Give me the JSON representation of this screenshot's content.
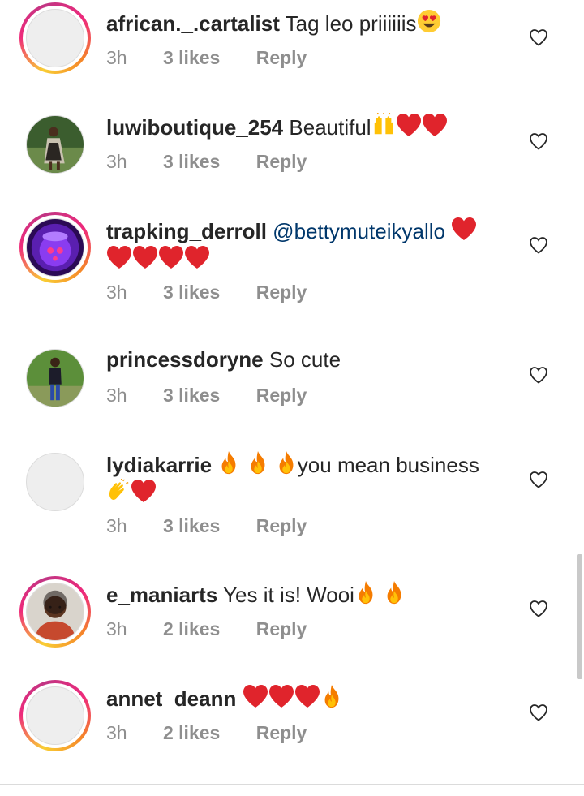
{
  "comments": [
    {
      "username": "african._.cartalist",
      "text": "Tag leo priiiiiis",
      "emojis": [
        "heart-eyes"
      ],
      "time": "3h",
      "likes": "3 likes",
      "reply": "Reply",
      "avatar": "default",
      "story_ring": true
    },
    {
      "username": "luwiboutique_254",
      "text": "Beautiful",
      "emojis": [
        "raised-hands",
        "red-heart",
        "red-heart"
      ],
      "time": "3h",
      "likes": "3 likes",
      "reply": "Reply",
      "avatar": "photo-person-green",
      "story_ring": false
    },
    {
      "username": "trapking_derroll",
      "mention": "@bettymuteikyallo",
      "emojis": [
        "red-heart",
        "red-heart",
        "red-heart",
        "red-heart",
        "red-heart"
      ],
      "time": "3h",
      "likes": "3 likes",
      "reply": "Reply",
      "avatar": "photo-purple-mask",
      "story_ring": true
    },
    {
      "username": "princessdoryne",
      "text": "So cute",
      "time": "3h",
      "likes": "3 likes",
      "reply": "Reply",
      "avatar": "photo-person-grass",
      "story_ring": false
    },
    {
      "username": "lydiakarrie",
      "text": "you mean business",
      "emojis_before": [
        "fire",
        "fire",
        "fire"
      ],
      "emojis_after": [
        "clapping-hands",
        "red-heart"
      ],
      "time": "3h",
      "likes": "3 likes",
      "reply": "Reply",
      "avatar": "default",
      "story_ring": false
    },
    {
      "username": "e_maniarts",
      "text": "Yes it is! Wooi",
      "emojis": [
        "fire",
        "fire"
      ],
      "time": "3h",
      "likes": "2 likes",
      "reply": "Reply",
      "avatar": "photo-woman-red",
      "story_ring": true
    },
    {
      "username": "annet_deann",
      "emojis": [
        "red-heart",
        "red-heart",
        "red-heart",
        "fire"
      ],
      "time": "3h",
      "likes": "2 likes",
      "reply": "Reply",
      "avatar": "default",
      "story_ring": true
    }
  ],
  "colors": {
    "text": "#262626",
    "meta": "#8e8e8e",
    "mention": "#00376b",
    "heart": "#e0242c"
  },
  "icons": {
    "like": "heart-outline-icon"
  }
}
